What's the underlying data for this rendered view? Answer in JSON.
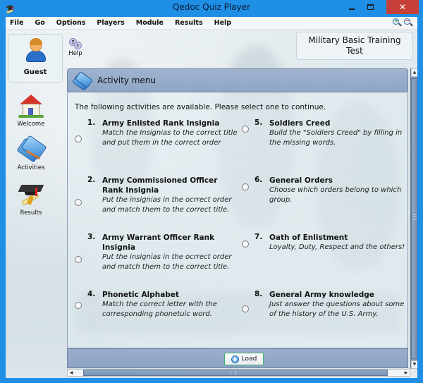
{
  "window": {
    "title": "Qedoc Quiz Player",
    "close_glyph": "✕"
  },
  "menu": {
    "items": [
      "File",
      "Go",
      "Options",
      "Players",
      "Module",
      "Results",
      "Help"
    ],
    "zoom_in": "+",
    "zoom_out": "−"
  },
  "user": {
    "name": "Guest"
  },
  "help": {
    "label": "Help"
  },
  "test": {
    "title": "Military Basic Training Test"
  },
  "nav": {
    "items": [
      {
        "label": "Welcome",
        "icon": "house-icon"
      },
      {
        "label": "Activities",
        "icon": "books-icon"
      },
      {
        "label": "Results",
        "icon": "graduation-cap-icon"
      }
    ]
  },
  "panel": {
    "title": "Activity menu",
    "intro": "The following activities are available. Please select one to continue.",
    "activities": [
      {
        "num": "1.",
        "title": "Army Enlisted Rank Insignia",
        "desc": "Match the Insignias to the correct title and put them in the correct order"
      },
      {
        "num": "2.",
        "title": "Army Commissioned Officer Rank Insignia",
        "desc": "Put the insignias in the ocrrect order and match them to the correct title."
      },
      {
        "num": "3.",
        "title": "Army Warrant Officer Rank Insignia",
        "desc": "Put the insignias in the ocrrect order and match them to the correct title."
      },
      {
        "num": "4.",
        "title": "Phonetic Alphabet",
        "desc": "Match the correct letter with the corresponding phonetuic word."
      },
      {
        "num": "5.",
        "title": "Soldiers Creed",
        "desc": "Build the \"Soldiers Creed\" by filling in the missing words."
      },
      {
        "num": "6.",
        "title": "General Orders",
        "desc": "Choose which orders belong to which group."
      },
      {
        "num": "7.",
        "title": "Oath of Enlistment",
        "desc": "Loyalty, Duty, Respect and the others!"
      },
      {
        "num": "8.",
        "title": "General Army knowledge",
        "desc": "Just answer the questions about some of the history of the U.S. Army."
      }
    ],
    "load_label": "Load"
  },
  "scroll": {
    "up": "▲",
    "down": "▼",
    "left": "◀",
    "right": "▶"
  }
}
